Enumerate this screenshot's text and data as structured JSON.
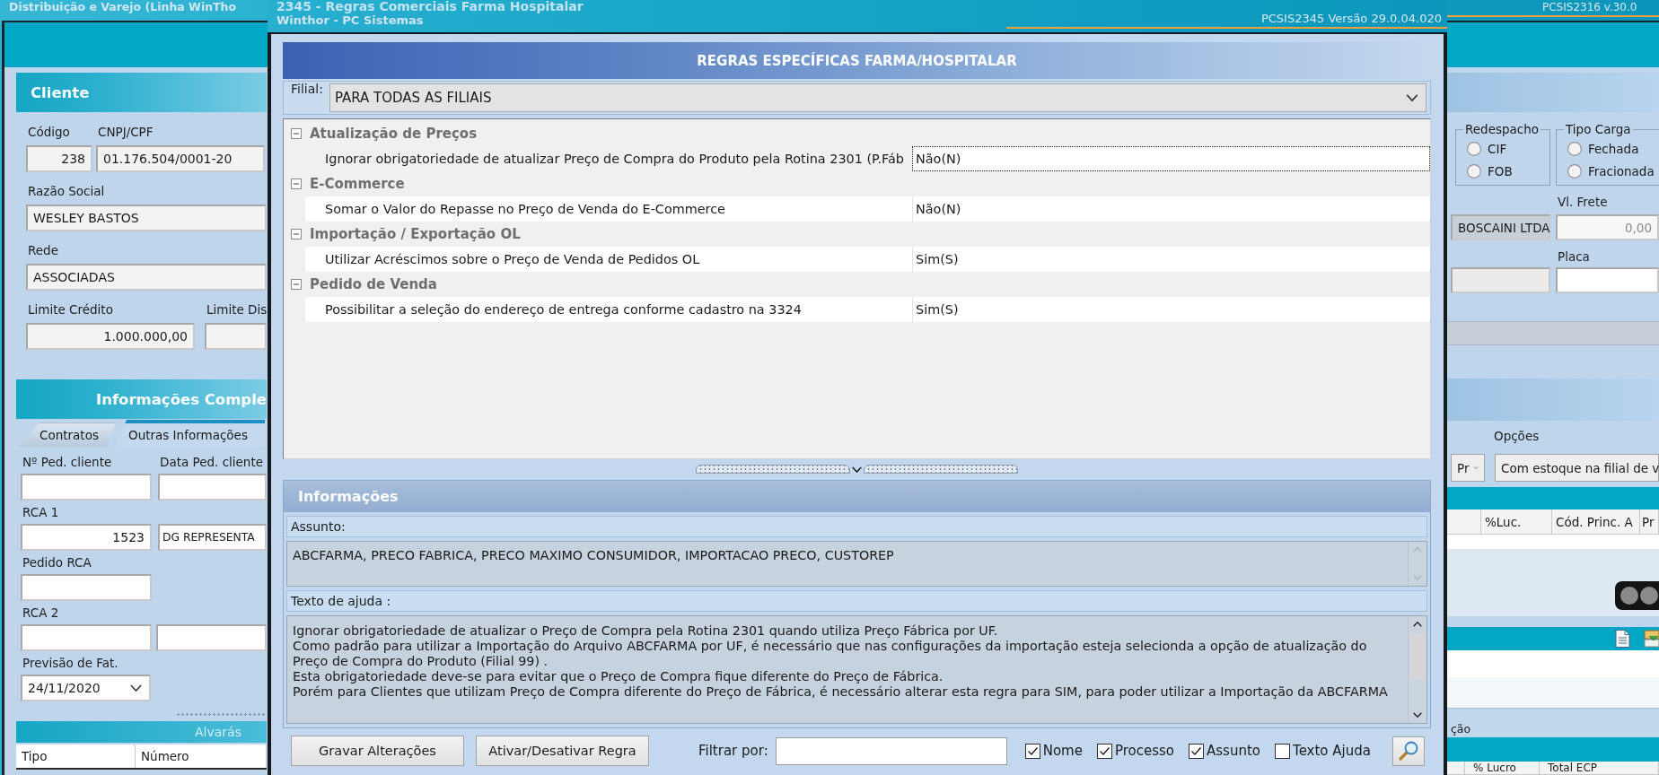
{
  "app_window": {
    "title": "Distribuição e Varejo (Linha WinTho",
    "version": "PCSIS2316 v.30.0"
  },
  "cliente_panel": {
    "title": "Cliente",
    "codigo": {
      "label": "Código",
      "value": "238"
    },
    "cnpj_cpf": {
      "label": "CNPJ/CPF",
      "value": "01.176.504/0001-20"
    },
    "razao_social": {
      "label": "Razão Social",
      "value": "WESLEY BASTOS"
    },
    "rede": {
      "label": "Rede",
      "value": "ASSOCIADAS"
    },
    "limite_credito": {
      "label": "Limite Crédito",
      "value": "1.000.000,00"
    },
    "limite_dis": {
      "label": "Limite Dis"
    }
  },
  "info_panel": {
    "title": "Informações Comple",
    "tabs": [
      {
        "label": "Contratos",
        "selected": false
      },
      {
        "label": "Outras Informações",
        "selected": true
      }
    ],
    "ped_cliente": {
      "label": "Nº Ped. cliente"
    },
    "data_ped_cliente": {
      "label": "Data Ped. cliente"
    },
    "rca_1": {
      "label": "RCA 1",
      "code": "1523",
      "name": "DG REPRESENTA"
    },
    "pedido_rca": {
      "label": "Pedido RCA"
    },
    "rca_2": {
      "label": "RCA 2"
    },
    "previsao_fat": {
      "label": "Previsão de Fat.",
      "value": "24/11/2020"
    }
  },
  "alvaras": {
    "title": "Alvarás",
    "columns": [
      "Tipo",
      "Número"
    ]
  },
  "right_panel": {
    "redespacho": {
      "title": "Redespacho",
      "options": [
        {
          "label": "CIF",
          "selected": false
        },
        {
          "label": "FOB",
          "selected": false
        }
      ]
    },
    "tipo_carga": {
      "title": "Tipo Carga",
      "options": [
        {
          "label": "Fechada",
          "selected": false
        },
        {
          "label": "Fracionada",
          "selected": false
        }
      ]
    },
    "transportadora": "BOSCAINI LTDA",
    "vl_frete": {
      "label": "Vl. Frete",
      "value": "0,00",
      "disabled": true
    },
    "placa": {
      "label": "Placa"
    },
    "opcoes": {
      "label": "Opções",
      "combo_1": "Pr",
      "combo_2": "Com estoque na filial de v"
    },
    "grid_columns": [
      "%Luc.",
      "Cód. Princ. A",
      "Pr"
    ],
    "status_label": "ção",
    "bottom_columns": [
      "% Lucro",
      "Total ECP"
    ]
  },
  "dialog": {
    "title": "2345 - Regras Comerciais Farma Hospitalar",
    "subtitle": "Winthor - PC Sistemas",
    "version": "PCSIS2345 Versão 29.0.04.020",
    "header": "REGRAS ESPECÍFICAS FARMA/HOSPITALAR",
    "filial": {
      "label": "Filial:",
      "value": "PARA TODAS AS FILIAIS"
    },
    "rules": [
      {
        "group": "Atualização de Preços",
        "expanded": true,
        "children": [
          {
            "name": "Ignorar obrigatoriedade de atualizar Preço de Compra do Produto pela Rotina 2301 (P.Fáb",
            "value": "Não(N)",
            "selected": true
          }
        ]
      },
      {
        "group": "E-Commerce",
        "expanded": true,
        "children": [
          {
            "name": "Somar o Valor do Repasse no Preço de Venda do E-Commerce",
            "value": "Não(N)",
            "selected": false
          }
        ]
      },
      {
        "group": "Importação / Exportação OL",
        "expanded": true,
        "children": [
          {
            "name": "Utilizar Acréscimos sobre o Preço de Venda de Pedidos OL",
            "value": "Sim(S)",
            "selected": false
          }
        ]
      },
      {
        "group": "Pedido de Venda",
        "expanded": true,
        "children": [
          {
            "name": "Possibilitar a seleção do endereço de entrega conforme cadastro na 3324",
            "value": "Sim(S)",
            "selected": false
          }
        ]
      }
    ],
    "info": {
      "title": "Informações",
      "assunto_label": "Assunto:",
      "assunto": "ABCFARMA, PRECO FABRICA, PRECO MAXIMO CONSUMIDOR, IMPORTACAO PRECO, CUSTOREP",
      "ajuda_label": "Texto de ajuda :",
      "ajuda": [
        "Ignorar obrigatoriedade de atualizar o Preço de Compra pela Rotina 2301 quando utiliza Preço Fábrica por UF.",
        "Como padrão para utilizar a Importação do Arquivo ABCFARMA por UF, é necessário que nas configurações da importação esteja selecionda a opção de atualização do Preço de Compra do Produto (Filial 99) .",
        "Esta obrigatoriedade deve-se para evitar que o Preço de Compra fique diferente do Preço de Fábrica.",
        "Porém para Clientes que utilizam Preço de Compra diferente do Preço de Fábrica, é necessário alterar esta regra para SIM, para poder utilizar a Importação da ABCFARMA"
      ]
    },
    "buttons": [
      "Gravar Alterações",
      "Ativar/Desativar Regra"
    ],
    "filter": {
      "label": "Filtrar por:",
      "options": [
        {
          "label": "Nome",
          "checked": true
        },
        {
          "label": "Processo",
          "checked": true
        },
        {
          "label": "Assunto",
          "checked": true
        },
        {
          "label": "Texto Ajuda",
          "checked": false
        }
      ]
    }
  }
}
